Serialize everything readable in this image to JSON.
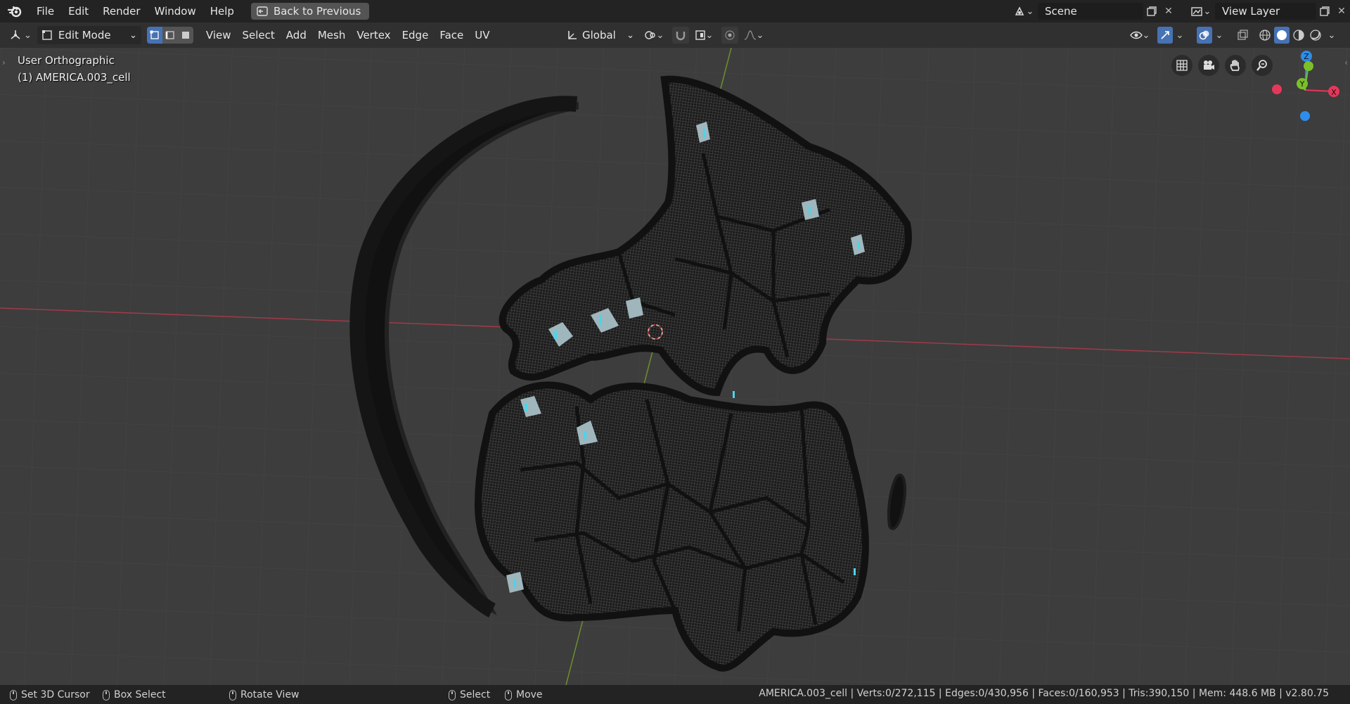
{
  "topbar": {
    "menus": [
      "File",
      "Edit",
      "Render",
      "Window",
      "Help"
    ],
    "back_button": "Back to Previous",
    "scene": "Scene",
    "view_layer": "View Layer"
  },
  "header": {
    "mode": "Edit Mode",
    "menus": [
      "View",
      "Select",
      "Add",
      "Mesh",
      "Vertex",
      "Edge",
      "Face",
      "UV"
    ],
    "orientation": "Global"
  },
  "viewport": {
    "view_name": "User Orthographic",
    "object_name": "(1) AMERICA.003_cell",
    "gizmo": {
      "x": "X",
      "y": "Y",
      "z": "Z"
    }
  },
  "statusbar": {
    "set_cursor": "Set 3D Cursor",
    "box_select": "Box Select",
    "rotate_view": "Rotate View",
    "select": "Select",
    "move": "Move",
    "stats": "AMERICA.003_cell | Verts:0/272,115 | Edges:0/430,956 | Faces:0/160,953 | Tris:390,150 | Mem: 448.6 MB | v2.80.75"
  },
  "colors": {
    "accent_blue": "#4772b3",
    "axis_x": "#e6375a",
    "axis_y": "#7cbf2a",
    "axis_z": "#2e8dea",
    "selection_cyan": "#4fd3e8"
  }
}
